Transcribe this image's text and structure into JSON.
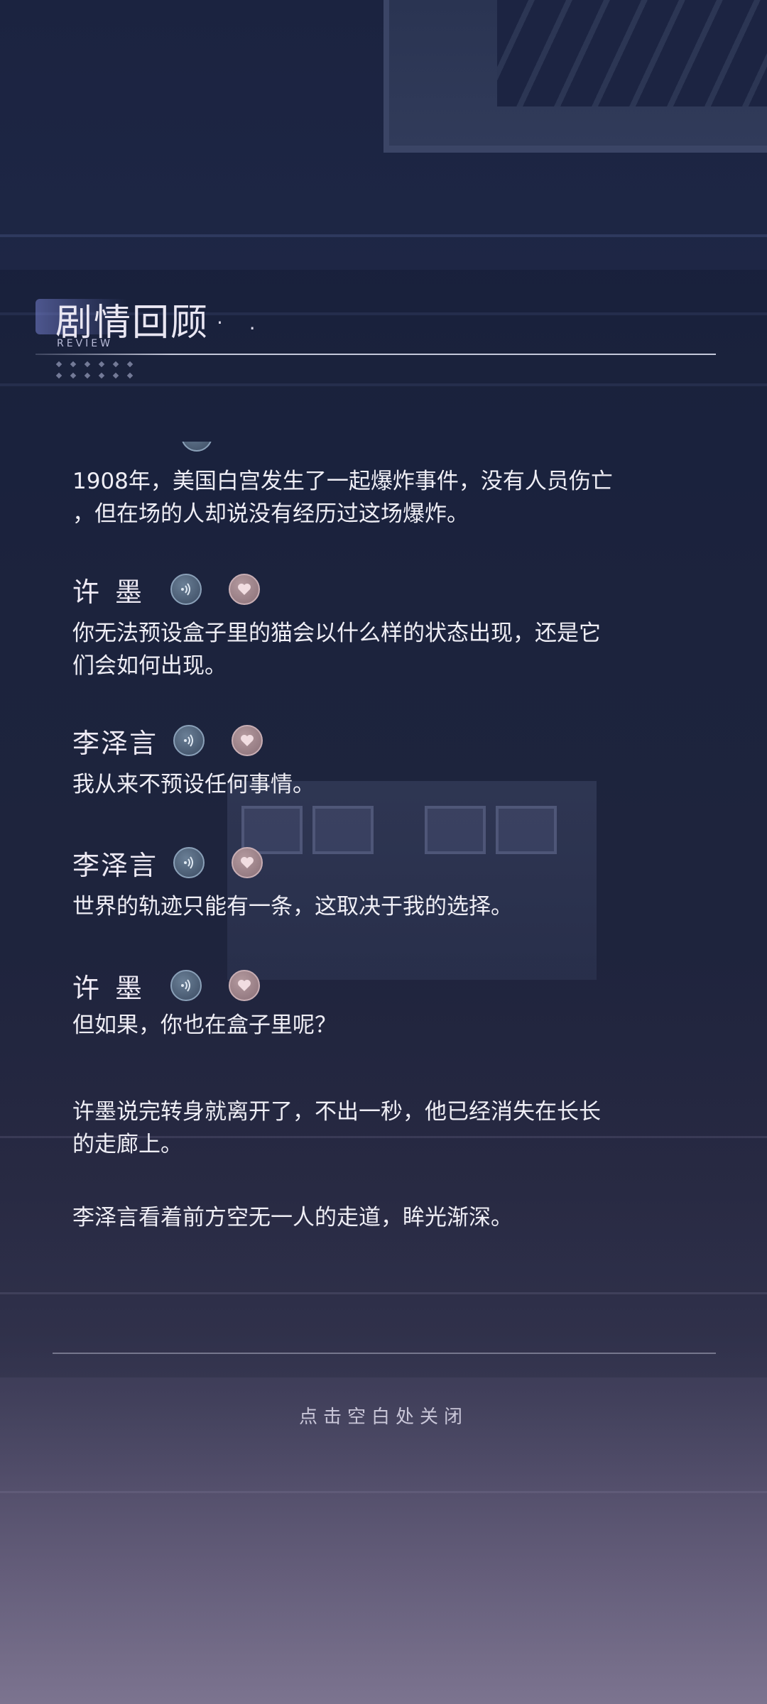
{
  "header": {
    "title": "剧情回顾",
    "dots": "· .",
    "subtitle": "REVIEW"
  },
  "entries": [
    {
      "type": "line",
      "speaker": "",
      "text": "1908年，美国白宫发生了一起爆炸事件，没有人员伤亡\n，但在场的人却说没有经历过这场爆炸。"
    },
    {
      "type": "line",
      "speaker": "许墨",
      "text": "你无法预设盒子里的猫会以什么样的状态出现，还是它\n们会如何出现。"
    },
    {
      "type": "line",
      "speaker": "李泽言",
      "text": "我从来不预设任何事情。"
    },
    {
      "type": "line",
      "speaker": "李泽言",
      "text": "世界的轨迹只能有一条，这取决于我的选择。"
    },
    {
      "type": "line",
      "speaker": "许墨",
      "text": "但如果，你也在盒子里呢？"
    },
    {
      "type": "narration",
      "text": "许墨说完转身就离开了，不出一秒，他已经消失在长长\n的走廊上。"
    },
    {
      "type": "narration",
      "text": "李泽言看着前方空无一人的走道，眸光渐深。"
    }
  ],
  "icons": {
    "voice": "voice-play-icon",
    "like": "heart-icon"
  },
  "footer": {
    "close_hint": "点击空白处关闭"
  }
}
